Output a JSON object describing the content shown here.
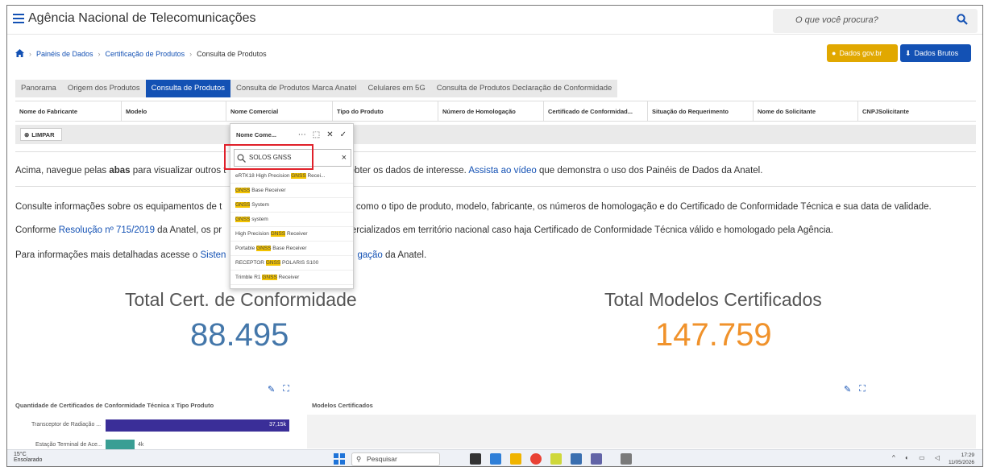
{
  "header": {
    "site_title": "Agência Nacional de Telecomunicações",
    "search_placeholder": "O que você procura?"
  },
  "breadcrumb": {
    "items": [
      "Painéis de Dados",
      "Certificação de Produtos",
      "Consulta de Produtos"
    ]
  },
  "actions": {
    "dados_gov": "Dados gov.br",
    "dados_brutos": "Dados Brutos"
  },
  "tabs": [
    {
      "label": "Panorama",
      "active": false
    },
    {
      "label": "Origem dos Produtos",
      "active": false
    },
    {
      "label": "Consulta de Produtos",
      "active": true
    },
    {
      "label": "Consulta de Produtos Marca Anatel",
      "active": false
    },
    {
      "label": "Celulares em 5G",
      "active": false
    },
    {
      "label": "Consulta de Produtos Declaração de Conformidade",
      "active": false
    }
  ],
  "filters": {
    "columns": [
      "Nome do Fabricante",
      "Modelo",
      "Nome Comercial",
      "Tipo do Produto",
      "Número de Homologação",
      "Certificado de Conformidad...",
      "Situação do Requerimento",
      "Nome do Solicitante",
      "CNPJSolicitante"
    ],
    "clear_label": "LIMPAR"
  },
  "body": {
    "p1_a": "Acima, navegue pelas ",
    "p1_b": "abas",
    "p1_c": " para visualizar outros t",
    "p1_d": " obter os dados de interesse. ",
    "p1_link": "Assista ao vídeo",
    "p1_e": " que demonstra o uso dos Painéis de Dados da Anatel.",
    "p2_a": "Consulte informações sobre os equipamentos de t",
    "p2_b": "os, como o tipo de produto, modelo, fabricante, os números de homologação e do Certificado de Conformidade Técnica e sua data de validade.",
    "p3_a": "Conforme ",
    "p3_link": "Resolução nº 715/2019",
    "p3_b": " da Anatel, os pr",
    "p3_c": "r comercializados em território nacional caso haja Certificado de Conformidade Técnica válido e homologado pela Agência.",
    "p4_a": "Para informações mais detalhadas acesse o ",
    "p4_link": "Sisten",
    "p4_link2": "gação",
    "p4_b": " da Anatel."
  },
  "kpis": {
    "cert_label": "Total Cert. de Conformidade",
    "cert_value": "88.495",
    "models_label": "Total Modelos Certificados",
    "models_value": "147.759",
    "cert_color": "#4477aa",
    "models_color": "#f0922b"
  },
  "charts": {
    "left_title": "Quantidade de Certificados de Conformidade Técnica x Tipo Produto",
    "right_title": "Modelos Certificados",
    "bars": [
      {
        "label": "Transceptor de Radiação ...",
        "value_label": "37,15k",
        "fraction": 1.0,
        "color": "#3a2e98"
      },
      {
        "label": "Estação Terminal de Ace...",
        "value_label": "4k",
        "fraction": 0.2,
        "color": "#3a9e94"
      }
    ]
  },
  "dropdown": {
    "header": "Nome Come...",
    "search_value": "SOLOS GNSS",
    "items": [
      {
        "pre": "eRTK18 High Precision ",
        "hl": "GNSS",
        "post": " Recei..."
      },
      {
        "pre": "",
        "hl": "GNSS",
        "post": " Base Receiver"
      },
      {
        "pre": "",
        "hl": "GNSS",
        "post": " System"
      },
      {
        "pre": "",
        "hl": "GNSS",
        "post": " system"
      },
      {
        "pre": "High Precision ",
        "hl": "GNSS",
        "post": " Receiver"
      },
      {
        "pre": "Portable ",
        "hl": "GNSS",
        "post": " Base Receiver"
      },
      {
        "pre": "RECEPTOR ",
        "hl": "GNSS",
        "post": " POLARIS S100"
      },
      {
        "pre": "Trimble R1 ",
        "hl": "GNSS",
        "post": " Receiver"
      }
    ]
  },
  "taskbar": {
    "temp": "15°C",
    "weather": "Ensolarado",
    "search": "Pesquisar",
    "time": "17:29",
    "date": "11/05/2026"
  }
}
